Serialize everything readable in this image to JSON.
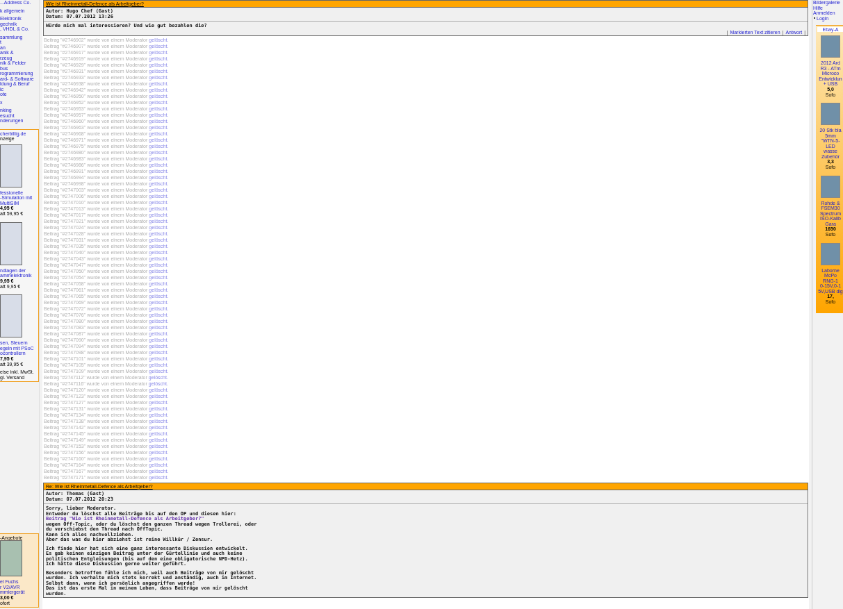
{
  "left_nav": [
    [
      "...Address Co."
    ],
    [
      "k allgemein"
    ],
    [
      "Elektronik",
      "gechnik",
      ", VHDL & Co."
    ],
    [
      "sammlung",
      "t",
      "an",
      "anik &",
      "rzeug",
      "nik & Felder",
      "bus",
      "rogrammierung",
      "ard- & Software",
      "ldung & Beruf",
      "ic",
      "ote"
    ],
    [
      "x"
    ],
    [
      "nking",
      "esucht",
      "nderungen"
    ]
  ],
  "left_ads": {
    "title": "cherbillig.de",
    "subtitle": "nzeige",
    "books": [
      {
        "lines": [
          "fessionelle",
          "-Simulation mit",
          "MultiSIM"
        ],
        "price": "4,95 €",
        "old_price": "att 59,95 €"
      },
      {
        "lines": [
          "ndlagen der",
          "ammelektronik"
        ],
        "price": "9,95 €",
        "old_price": "att 9,95 €"
      },
      {
        "lines": [
          "sen, Steuern",
          "egeln mit PSoC",
          "ocontrollern"
        ],
        "price": "7,95 €",
        "old_price": "att 39,95 €"
      }
    ],
    "footer": [
      "eise inkl. MwSt.",
      "gl. Versand"
    ]
  },
  "left_offers": {
    "title": "-Angebote",
    "lines": [
      "el Fuchs",
      "r V2/AVR",
      "mmiergerät"
    ],
    "price": "3,00 €",
    "note": "ofort"
  },
  "posts": [
    {
      "title": "Wie ist Rheinmetall-Defence als Arbeitgeber?",
      "author": "Autor: Hugo Chef (Gast)",
      "date": "Datum: 07.07.2012 13:26",
      "paragraphs": [
        [
          {
            "kind": "text",
            "text": "Würde mich mal interessieren? Und wie gut bezahlen die?"
          }
        ]
      ],
      "actions": [
        "Markierten Text zitieren",
        "Antwort"
      ],
      "separator": "|"
    }
  ],
  "deleted_posts": [
    {
      "text": "Beitrag \"#2746902\" wurde von einem Moderator",
      "link": "gelöscht."
    },
    {
      "text": "Beitrag \"#2746907\" wurde von einem Moderator",
      "link": "gelöscht."
    },
    {
      "text": "Beitrag \"#2746917\" wurde von einem Moderator",
      "link": "gelöscht."
    },
    {
      "text": "Beitrag \"#2746919\" wurde von einem Moderator",
      "link": "gelöscht."
    },
    {
      "text": "Beitrag \"#2746929\" wurde von einem Moderator",
      "link": "gelöscht."
    },
    {
      "text": "Beitrag \"#2746931\" wurde von einem Moderator",
      "link": "gelöscht."
    },
    {
      "text": "Beitrag \"#2746933\" wurde von einem Moderator",
      "link": "gelöscht."
    },
    {
      "text": "Beitrag \"#2746938\" wurde von einem Moderator",
      "link": "gelöscht."
    },
    {
      "text": "Beitrag \"#2746942\" wurde von einem Moderator",
      "link": "gelöscht."
    },
    {
      "text": "Beitrag \"#2746950\" wurde von einem Moderator",
      "link": "gelöscht."
    },
    {
      "text": "Beitrag \"#2746952\" wurde von einem Moderator",
      "link": "gelöscht."
    },
    {
      "text": "Beitrag \"#2746953\" wurde von einem Moderator",
      "link": "gelöscht."
    },
    {
      "text": "Beitrag \"#2746957\" wurde von einem Moderator",
      "link": "gelöscht."
    },
    {
      "text": "Beitrag \"#2746960\" wurde von einem Moderator",
      "link": "gelöscht."
    },
    {
      "text": "Beitrag \"#2746963\" wurde von einem Moderator",
      "link": "gelöscht."
    },
    {
      "text": "Beitrag \"#2746968\" wurde von einem Moderator",
      "link": "gelöscht."
    },
    {
      "text": "Beitrag \"#2746971\" wurde von einem Moderator",
      "link": "gelöscht."
    },
    {
      "text": "Beitrag \"#2746975\" wurde von einem Moderator",
      "link": "gelöscht."
    },
    {
      "text": "Beitrag \"#2746980\" wurde von einem Moderator",
      "link": "gelöscht."
    },
    {
      "text": "Beitrag \"#2746983\" wurde von einem Moderator",
      "link": "gelöscht."
    },
    {
      "text": "Beitrag \"#2746986\" wurde von einem Moderator",
      "link": "gelöscht."
    },
    {
      "text": "Beitrag \"#2746991\" wurde von einem Moderator",
      "link": "gelöscht."
    },
    {
      "text": "Beitrag \"#2746994\" wurde von einem Moderator",
      "link": "gelöscht."
    },
    {
      "text": "Beitrag \"#2746998\" wurde von einem Moderator",
      "link": "gelöscht."
    },
    {
      "text": "Beitrag \"#2747003\" wurde von einem Moderator",
      "link": "gelöscht."
    },
    {
      "text": "Beitrag \"#2747006\" wurde von einem Moderator",
      "link": "gelöscht."
    },
    {
      "text": "Beitrag \"#2747010\" wurde von einem Moderator",
      "link": "gelöscht."
    },
    {
      "text": "Beitrag \"#2747013\" wurde von einem Moderator",
      "link": "gelöscht."
    },
    {
      "text": "Beitrag \"#2747017\" wurde von einem Moderator",
      "link": "gelöscht."
    },
    {
      "text": "Beitrag \"#2747021\" wurde von einem Moderator",
      "link": "gelöscht."
    },
    {
      "text": "Beitrag \"#2747024\" wurde von einem Moderator",
      "link": "gelöscht."
    },
    {
      "text": "Beitrag \"#2747028\" wurde von einem Moderator",
      "link": "gelöscht."
    },
    {
      "text": "Beitrag \"#2747031\" wurde von einem Moderator",
      "link": "gelöscht."
    },
    {
      "text": "Beitrag \"#2747035\" wurde von einem Moderator",
      "link": "gelöscht."
    },
    {
      "text": "Beitrag \"#2747040\" wurde von einem Moderator",
      "link": "gelöscht."
    },
    {
      "text": "Beitrag \"#2747043\" wurde von einem Moderator",
      "link": "gelöscht."
    },
    {
      "text": "Beitrag \"#2747047\" wurde von einem Moderator",
      "link": "gelöscht."
    },
    {
      "text": "Beitrag \"#2747050\" wurde von einem Moderator",
      "link": "gelöscht."
    },
    {
      "text": "Beitrag \"#2747054\" wurde von einem Moderator",
      "link": "gelöscht."
    },
    {
      "text": "Beitrag \"#2747058\" wurde von einem Moderator",
      "link": "gelöscht."
    },
    {
      "text": "Beitrag \"#2747061\" wurde von einem Moderator",
      "link": "gelöscht."
    },
    {
      "text": "Beitrag \"#2747065\" wurde von einem Moderator",
      "link": "gelöscht."
    },
    {
      "text": "Beitrag \"#2747069\" wurde von einem Moderator",
      "link": "gelöscht."
    },
    {
      "text": "Beitrag \"#2747072\" wurde von einem Moderator",
      "link": "gelöscht."
    },
    {
      "text": "Beitrag \"#2747076\" wurde von einem Moderator",
      "link": "gelöscht."
    },
    {
      "text": "Beitrag \"#2747080\" wurde von einem Moderator",
      "link": "gelöscht."
    },
    {
      "text": "Beitrag \"#2747083\" wurde von einem Moderator",
      "link": "gelöscht."
    },
    {
      "text": "Beitrag \"#2747087\" wurde von einem Moderator",
      "link": "gelöscht."
    },
    {
      "text": "Beitrag \"#2747090\" wurde von einem Moderator",
      "link": "gelöscht."
    },
    {
      "text": "Beitrag \"#2747094\" wurde von einem Moderator",
      "link": "gelöscht."
    },
    {
      "text": "Beitrag \"#2747098\" wurde von einem Moderator",
      "link": "gelöscht."
    },
    {
      "text": "Beitrag \"#2747101\" wurde von einem Moderator",
      "link": "gelöscht."
    },
    {
      "text": "Beitrag \"#2747105\" wurde von einem Moderator",
      "link": "gelöscht."
    },
    {
      "text": "Beitrag \"#2747109\" wurde von einem Moderator",
      "link": "gelöscht."
    },
    {
      "text": "Beitrag \"#2747112\" wurde von einem Moderator",
      "link": "gelöscht."
    },
    {
      "text": "Beitrag \"#2747116\" wurde von einem Moderator",
      "link": "gelöscht."
    },
    {
      "text": "Beitrag \"#2747120\" wurde von einem Moderator",
      "link": "gelöscht."
    },
    {
      "text": "Beitrag \"#2747123\" wurde von einem Moderator",
      "link": "gelöscht."
    },
    {
      "text": "Beitrag \"#2747127\" wurde von einem Moderator",
      "link": "gelöscht."
    },
    {
      "text": "Beitrag \"#2747131\" wurde von einem Moderator",
      "link": "gelöscht."
    },
    {
      "text": "Beitrag \"#2747134\" wurde von einem Moderator",
      "link": "gelöscht."
    },
    {
      "text": "Beitrag \"#2747138\" wurde von einem Moderator",
      "link": "gelöscht."
    },
    {
      "text": "Beitrag \"#2747142\" wurde von einem Moderator",
      "link": "gelöscht."
    },
    {
      "text": "Beitrag \"#2747145\" wurde von einem Moderator",
      "link": "gelöscht."
    },
    {
      "text": "Beitrag \"#2747149\" wurde von einem Moderator",
      "link": "gelöscht."
    },
    {
      "text": "Beitrag \"#2747153\" wurde von einem Moderator",
      "link": "gelöscht."
    },
    {
      "text": "Beitrag \"#2747156\" wurde von einem Moderator",
      "link": "gelöscht."
    },
    {
      "text": "Beitrag \"#2747160\" wurde von einem Moderator",
      "link": "gelöscht."
    },
    {
      "text": "Beitrag \"#2747164\" wurde von einem Moderator",
      "link": "gelöscht."
    },
    {
      "text": "Beitrag \"#2747167\" wurde von einem Moderator",
      "link": "gelöscht."
    },
    {
      "text": "Beitrag \"#2747171\" wurde von einem Moderator",
      "link": "gelöscht."
    }
  ],
  "reply": {
    "title": "Re: Wie ist Rheinmetall-Defence als Arbeitgeber?",
    "author": "Autor: Thomas (Gast)",
    "date": "Datum: 07.07.2012 20:23",
    "paragraphs": [
      [
        {
          "kind": "text",
          "text": "Sorry, lieber Moderator."
        },
        {
          "kind": "text",
          "text": "Entweder du löschst alle Beiträge bis auf den OP und diesen hier:"
        },
        {
          "kind": "link",
          "text": "Beitrag \"Wie ist Rheinmetall-Defence als Arbeitgeber?\""
        },
        {
          "kind": "text",
          "text": "wegen Off-Topic, oder du löschst den ganzen Thread wegen Trollerei, oder"
        },
        {
          "kind": "text",
          "text": "du verschiebst den Thread nach OffTopic."
        },
        {
          "kind": "text",
          "text": "Kann ich alles nachvollziehen."
        },
        {
          "kind": "text",
          "text": "Aber das was du hier abziehst ist reine Willkür / Zensur."
        }
      ],
      [
        {
          "kind": "text",
          "text": "Ich finde hier hat sich eine ganz interessante Diskussion entwickelt."
        },
        {
          "kind": "text",
          "text": "Es gab keinen einzigen Beitrag unter der Gürtellinie und auch keine"
        },
        {
          "kind": "text",
          "text": "politischen Entgleisungen (bis auf den eine obligatorische NPD-Hetz)."
        },
        {
          "kind": "text",
          "text": "Ich hätte diese Diskussion gerne weiter geführt."
        }
      ],
      [
        {
          "kind": "text",
          "text": "Besonders betroffen fühle ich mich, weil auch Beiträge von mir gelöscht"
        },
        {
          "kind": "text",
          "text": "wurden. Ich verhalte mich stets korrekt und anständig, auch im Internet."
        },
        {
          "kind": "text",
          "text": "Selbst dann, wenn ich persönlich angegriffen werde!"
        },
        {
          "kind": "text",
          "text": "Das ist das erste Mal in meinem Leben, dass Beiträge von mir gelöscht"
        },
        {
          "kind": "text",
          "text": "wurden."
        }
      ]
    ]
  },
  "right_nav": [
    "Bildergalerie",
    "Hilfe",
    "Anmelden"
  ],
  "login": "Login",
  "ebay": {
    "title": "Ebay-A",
    "items": [
      {
        "lines": [
          "2012 Ard",
          "R3 - ATm",
          "Microco",
          "Entwicklun",
          "+ USB"
        ],
        "price": "5,0",
        "note": "Sofo"
      },
      {
        "lines": [
          "20 Stk bla",
          "5mm",
          "\"WTN-5-",
          "LED",
          "wasse",
          "Zubehör"
        ],
        "price": "3,3",
        "note": "Sofo"
      },
      {
        "lines": [
          "Rohde &",
          "FSEM30",
          "Spectrum",
          "ISO-Kalib",
          "Gara"
        ],
        "price": "1650",
        "note": "Sofo"
      },
      {
        "lines": [
          "Laborne",
          "McPo",
          "RNG-1",
          "0-15V,0-1",
          "5V,USB dig"
        ],
        "price": "17,",
        "note": "Sofo"
      }
    ]
  }
}
